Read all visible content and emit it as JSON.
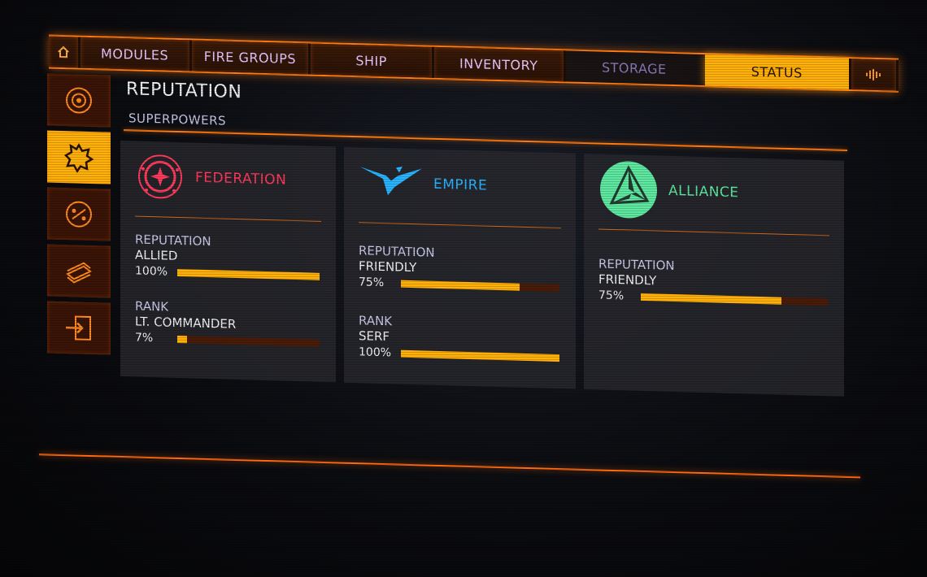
{
  "nav": {
    "home_icon": "home-icon",
    "tabs": [
      {
        "label": "MODULES"
      },
      {
        "label": "FIRE GROUPS"
      },
      {
        "label": "SHIP"
      },
      {
        "label": "INVENTORY"
      },
      {
        "label": "STORAGE"
      },
      {
        "label": "STATUS"
      }
    ],
    "audio_icon": "audio-wave-icon",
    "active_tab": "STATUS"
  },
  "sidebar": {
    "items": [
      {
        "icon": "galaxy-icon"
      },
      {
        "icon": "superpower-badge-icon",
        "active": true
      },
      {
        "icon": "faction-compass-icon"
      },
      {
        "icon": "credits-stack-icon"
      },
      {
        "icon": "transfer-icon"
      }
    ]
  },
  "page": {
    "title": "REPUTATION",
    "subtitle": "SUPERPOWERS"
  },
  "factions": [
    {
      "name": "FEDERATION",
      "color": "#ff3a5c",
      "emblem": "federation-emblem-icon",
      "reputation_label": "REPUTATION",
      "reputation_value": "ALLIED",
      "reputation_pct_text": "100%",
      "reputation_pct": 100,
      "rank_label": "RANK",
      "rank_value": "LT. COMMANDER",
      "rank_pct_text": "7%",
      "rank_pct": 7
    },
    {
      "name": "EMPIRE",
      "color": "#2ab4ff",
      "emblem": "empire-emblem-icon",
      "reputation_label": "REPUTATION",
      "reputation_value": "FRIENDLY",
      "reputation_pct_text": "75%",
      "reputation_pct": 75,
      "rank_label": "RANK",
      "rank_value": "SERF",
      "rank_pct_text": "100%",
      "rank_pct": 100
    },
    {
      "name": "ALLIANCE",
      "color": "#5ee8a0",
      "emblem": "alliance-emblem-icon",
      "reputation_label": "REPUTATION",
      "reputation_value": "FRIENDLY",
      "reputation_pct_text": "75%",
      "reputation_pct": 75
    }
  ],
  "colors": {
    "accent": "#ff7a10",
    "active_tab": "#ffb10a",
    "bar_fill": "#ffb10a",
    "bar_track": "#4a1c08"
  }
}
